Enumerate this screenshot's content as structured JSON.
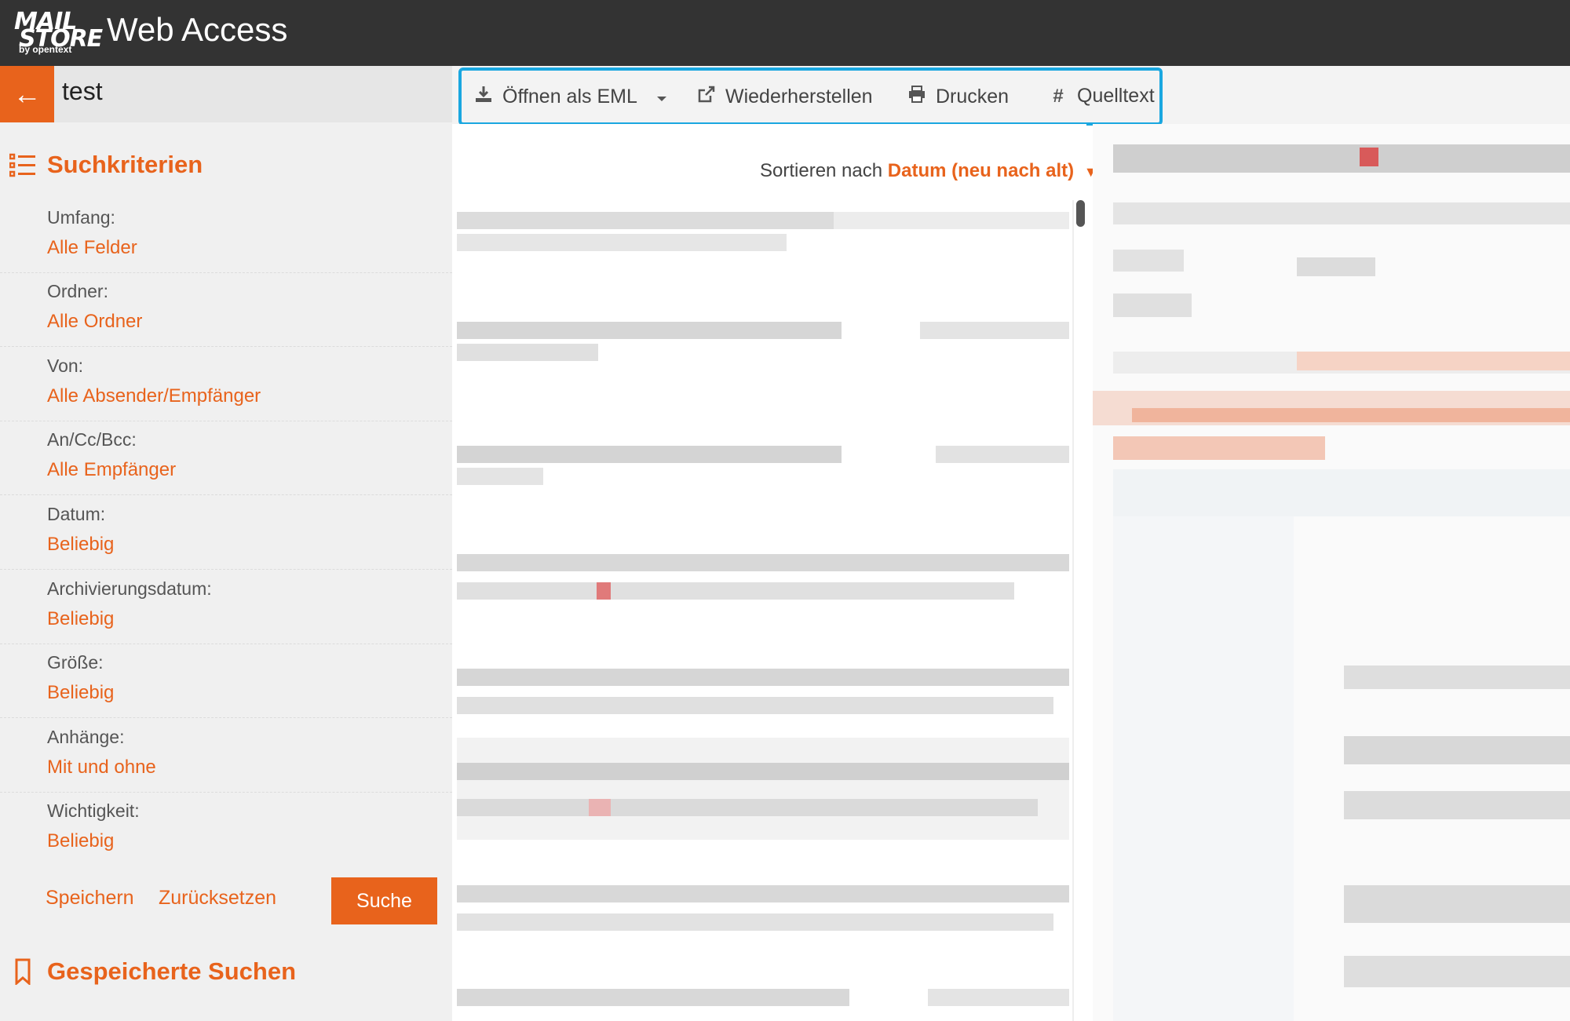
{
  "header": {
    "logo_line1": "MAIL",
    "logo_line2": "STORE",
    "logo_line3": "by opentext",
    "title": "Web Access"
  },
  "sidebar": {
    "search_name": "test",
    "criteria_title": "Suchkriterien",
    "criteria": [
      {
        "label": "Umfang:",
        "value": "Alle Felder"
      },
      {
        "label": "Ordner:",
        "value": "Alle Ordner"
      },
      {
        "label": "Von:",
        "value": "Alle Absender/Empfänger"
      },
      {
        "label": "An/Cc/Bcc:",
        "value": "Alle Empfänger"
      },
      {
        "label": "Datum:",
        "value": "Beliebig"
      },
      {
        "label": "Archivierungsdatum:",
        "value": "Beliebig"
      },
      {
        "label": "Größe:",
        "value": "Beliebig"
      },
      {
        "label": "Anhänge:",
        "value": "Mit und ohne"
      },
      {
        "label": "Wichtigkeit:",
        "value": "Beliebig"
      }
    ],
    "save_label": "Speichern",
    "reset_label": "Zurücksetzen",
    "search_label": "Suche",
    "saved_title": "Gespeicherte Suchen"
  },
  "toolbar": {
    "open_eml": "Öffnen als EML",
    "restore": "Wiederherstellen",
    "print": "Drucken",
    "source": "Quelltext"
  },
  "list": {
    "sort_prefix": "Sortieren nach",
    "sort_option": "Datum (neu nach alt)"
  },
  "colors": {
    "accent": "#e8631c",
    "header_bg": "#333333",
    "highlight": "#1aa7e0"
  },
  "icons": {
    "back": "arrow-left-icon",
    "criteria": "list-icon",
    "saved": "bookmark-icon",
    "open": "download-icon",
    "restore": "share-icon",
    "print": "printer-icon",
    "source": "hash-icon"
  }
}
